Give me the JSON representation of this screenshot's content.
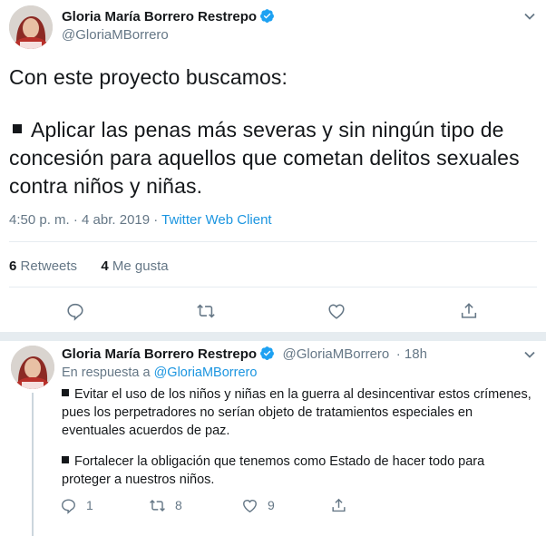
{
  "tweet": {
    "author_name": "Gloria María Borrero Restrepo",
    "author_handle": "@GloriaMBorrero",
    "intro": "Con este proyecto buscamos:",
    "bullet": "Aplicar las penas más severas y sin ningún tipo de concesión para aquellos que cometan delitos sexuales contra niños y niñas.",
    "time": "4:50 p. m. · 4 abr. 2019 · ",
    "client": "Twitter Web Client",
    "retweets_count": "6",
    "retweets_label": "Retweets",
    "likes_count": "4",
    "likes_label": "Me gusta"
  },
  "reply": {
    "author_name": "Gloria María Borrero Restrepo",
    "author_handle": "@GloriaMBorrero",
    "time": "· 18h",
    "in_reply_prefix": "En respuesta a ",
    "in_reply_handle": "@GloriaMBorrero",
    "bullet1": "Evitar el uso de los niños y niñas en la guerra al desincentivar estos crímenes, pues los perpetradores no serían objeto de tratamientos especiales en eventuales acuerdos de paz.",
    "bullet2": "Fortalecer la obligación que tenemos como Estado de hacer todo para proteger a nuestros niños.",
    "reply_count": "1",
    "retweet_count": "8",
    "like_count": "9"
  },
  "colors": {
    "accent": "#1b95e0",
    "verified": "#1da1f2",
    "muted": "#657786"
  }
}
